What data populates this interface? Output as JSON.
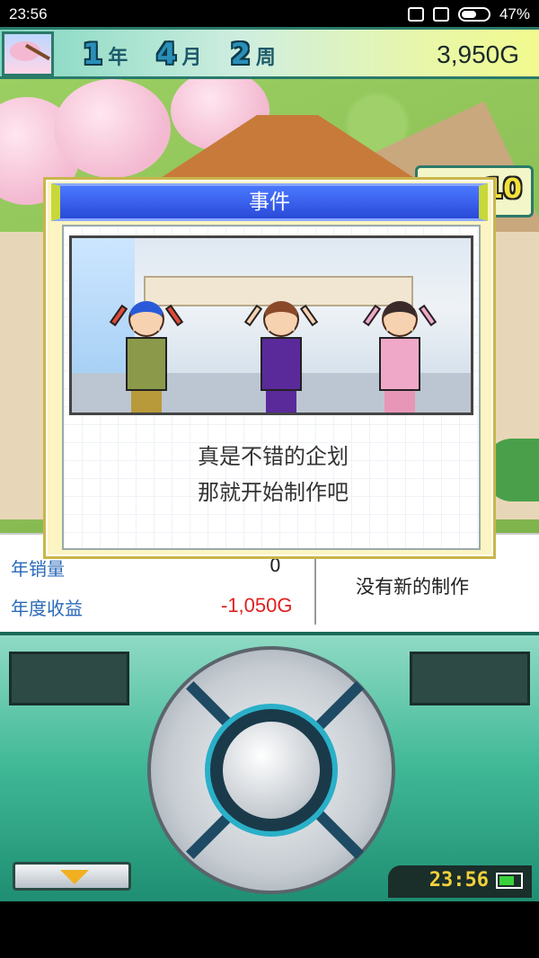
{
  "status_bar": {
    "time": "23:56",
    "battery": "47%"
  },
  "top_bar": {
    "year": "1",
    "year_unit": "年",
    "month": "4",
    "month_unit": "月",
    "week": "2",
    "week_unit": "周",
    "money": "3,950G"
  },
  "ticket_count": "10",
  "event_dialog": {
    "title": "事件",
    "message_line1": "真是不错的企划",
    "message_line2": "那就开始制作吧"
  },
  "stats": {
    "annual_sales_label": "年销量",
    "annual_sales_value": "0",
    "annual_revenue_label": "年度收益",
    "annual_revenue_value": "-1,050G",
    "production_status": "没有新的制作"
  },
  "controller": {
    "clock": "23:56"
  },
  "colors": {
    "revenue_negative": "#e02020",
    "dialog_title": "#2a4ad8",
    "accent": "#3fb896"
  }
}
